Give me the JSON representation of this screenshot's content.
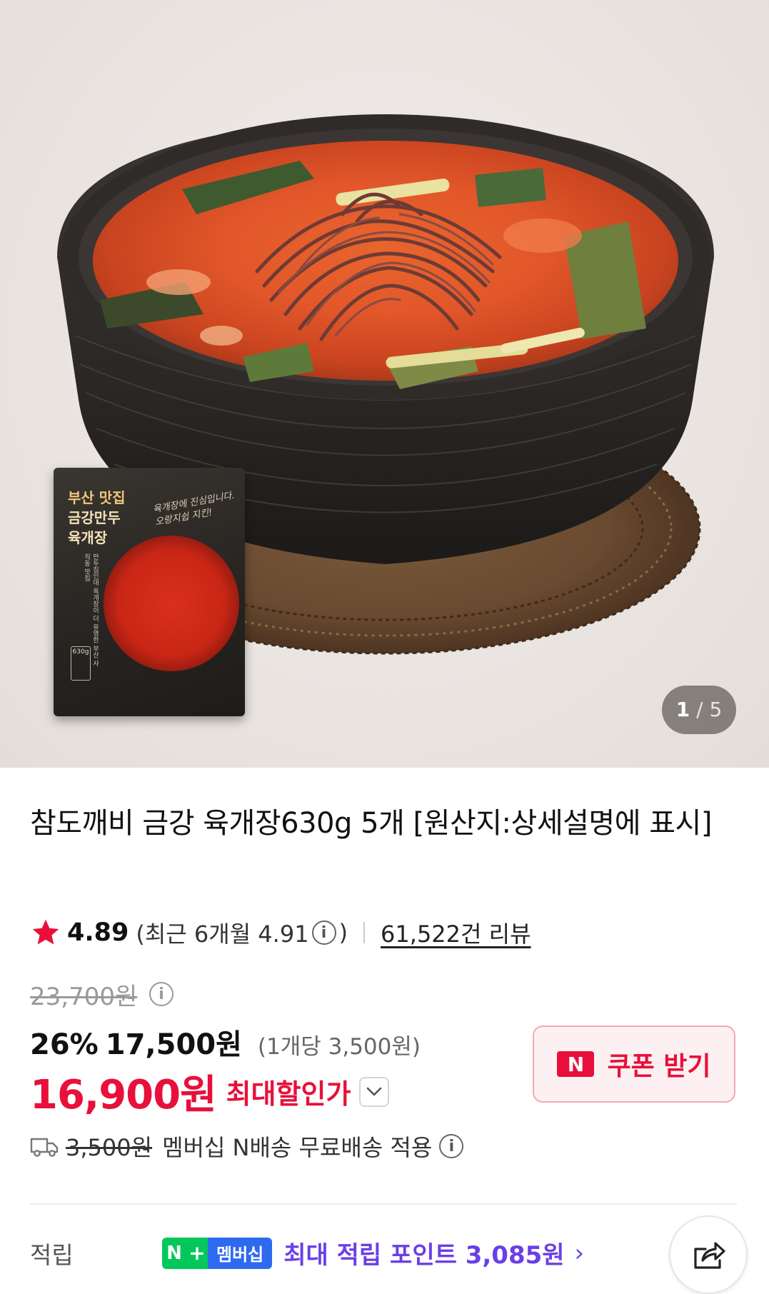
{
  "gallery": {
    "current": "1",
    "separator": "/",
    "total": "5",
    "pack": {
      "brand_line1": "부산 맛집",
      "brand_line2": "금강만두",
      "brand_line3": "육개장",
      "script_text": "육개장에 진심입니다. 오랑지쉽 지킨!",
      "side_text": "만두집인데 육개장이 더 유명한 부산 사직동 맛집",
      "weight_badge": "630g"
    }
  },
  "product": {
    "title": "참도깨비 금강 육개장630g 5개 [원산지:상세설명에 표시]"
  },
  "rating": {
    "score": "4.89",
    "recent_prefix": "(최근 6개월 4.91",
    "recent_suffix": ")",
    "info_glyph": "i",
    "reviews": "61,522건 리뷰"
  },
  "price": {
    "original": "23,700원",
    "discount_pct": "26%",
    "sale": "17,500원",
    "per_unit": "(1개당 3,500원)",
    "best": "16,900원",
    "best_label": "최대할인가"
  },
  "coupon": {
    "logo": "N",
    "label": "쿠폰 받기",
    "accent": "#e8103a"
  },
  "shipping": {
    "original_fee": "3,500원",
    "text": "멤버십 N배송 무료배송 적용"
  },
  "points": {
    "label": "적립",
    "badge_n": "N",
    "badge_plus": "+",
    "badge_text": "멤버십",
    "text": "최대 적립 포인트 3,085원",
    "chevron": "›"
  },
  "icons": [
    "star-icon",
    "info-icon",
    "chevron-down-icon",
    "truck-icon",
    "share-icon"
  ],
  "colors": {
    "sale_red": "#e8103a",
    "points_purple": "#6b3fe6",
    "naver_green": "#03c75a",
    "membership_blue": "#2d6af0"
  }
}
